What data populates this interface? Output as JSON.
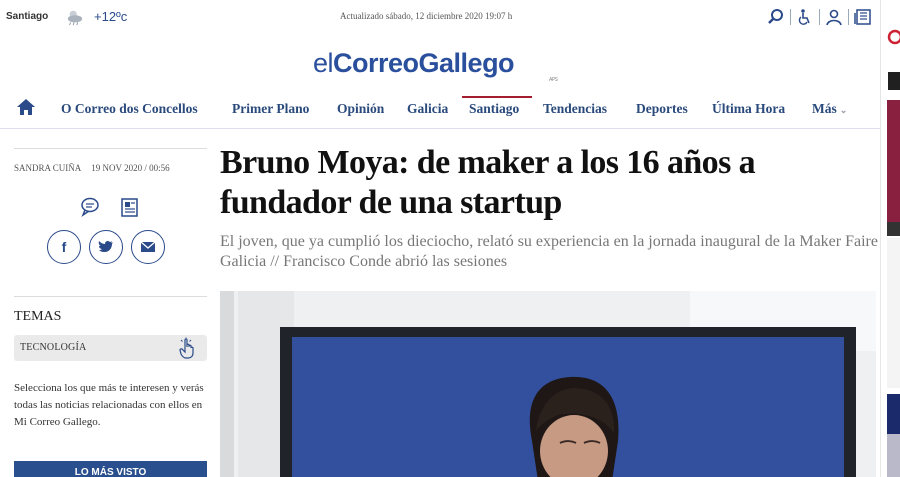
{
  "header": {
    "city": "Santiago",
    "weather_icon": "partly-cloudy-icon",
    "temperature": "+12ºc",
    "updated": "Actualizado  sábado, 12 diciembre 2020  19:07 h",
    "icons": [
      "search-icon",
      "accessibility-icon",
      "user-icon",
      "newspaper-icon"
    ]
  },
  "logo": {
    "prefix": "el",
    "brand": "CorreoGallego",
    "suffix": "APS"
  },
  "nav": {
    "home_icon": "home-icon",
    "items": [
      "O Correo dos Concellos",
      "Primer Plano",
      "Opinión",
      "Galicia",
      "Santiago",
      "Tendencias",
      "Deportes",
      "Última Hora",
      "Más"
    ],
    "active": "Santiago"
  },
  "article": {
    "author": "SANDRA CUIÑA",
    "date": "19 NOV 2020 / 00:56",
    "headline": "Bruno Moya: de maker a los 16 años a fundador de una startup",
    "subtitle": "El joven, que ya cumplió los dieciocho, relató su experiencia en la jornada inaugural de la Maker Faire Galicia // Francisco Conde abrió las sesiones"
  },
  "share": {
    "facebook": "f",
    "twitter": "twitter-icon",
    "mail": "mail-icon"
  },
  "sidebar": {
    "temas_title": "TEMAS",
    "tag_label": "TECNOLOGÍA",
    "temas_text": "Selecciona los que más te interesen y verás todas las noticias relacionadas con ellos en Mi Correo Gallego.",
    "lomas_label": "LO MÁS VISTO"
  },
  "colors": {
    "brand_blue": "#2a4f9c",
    "nav_text": "#2a4a7c",
    "active_red": "#a31d2e"
  }
}
